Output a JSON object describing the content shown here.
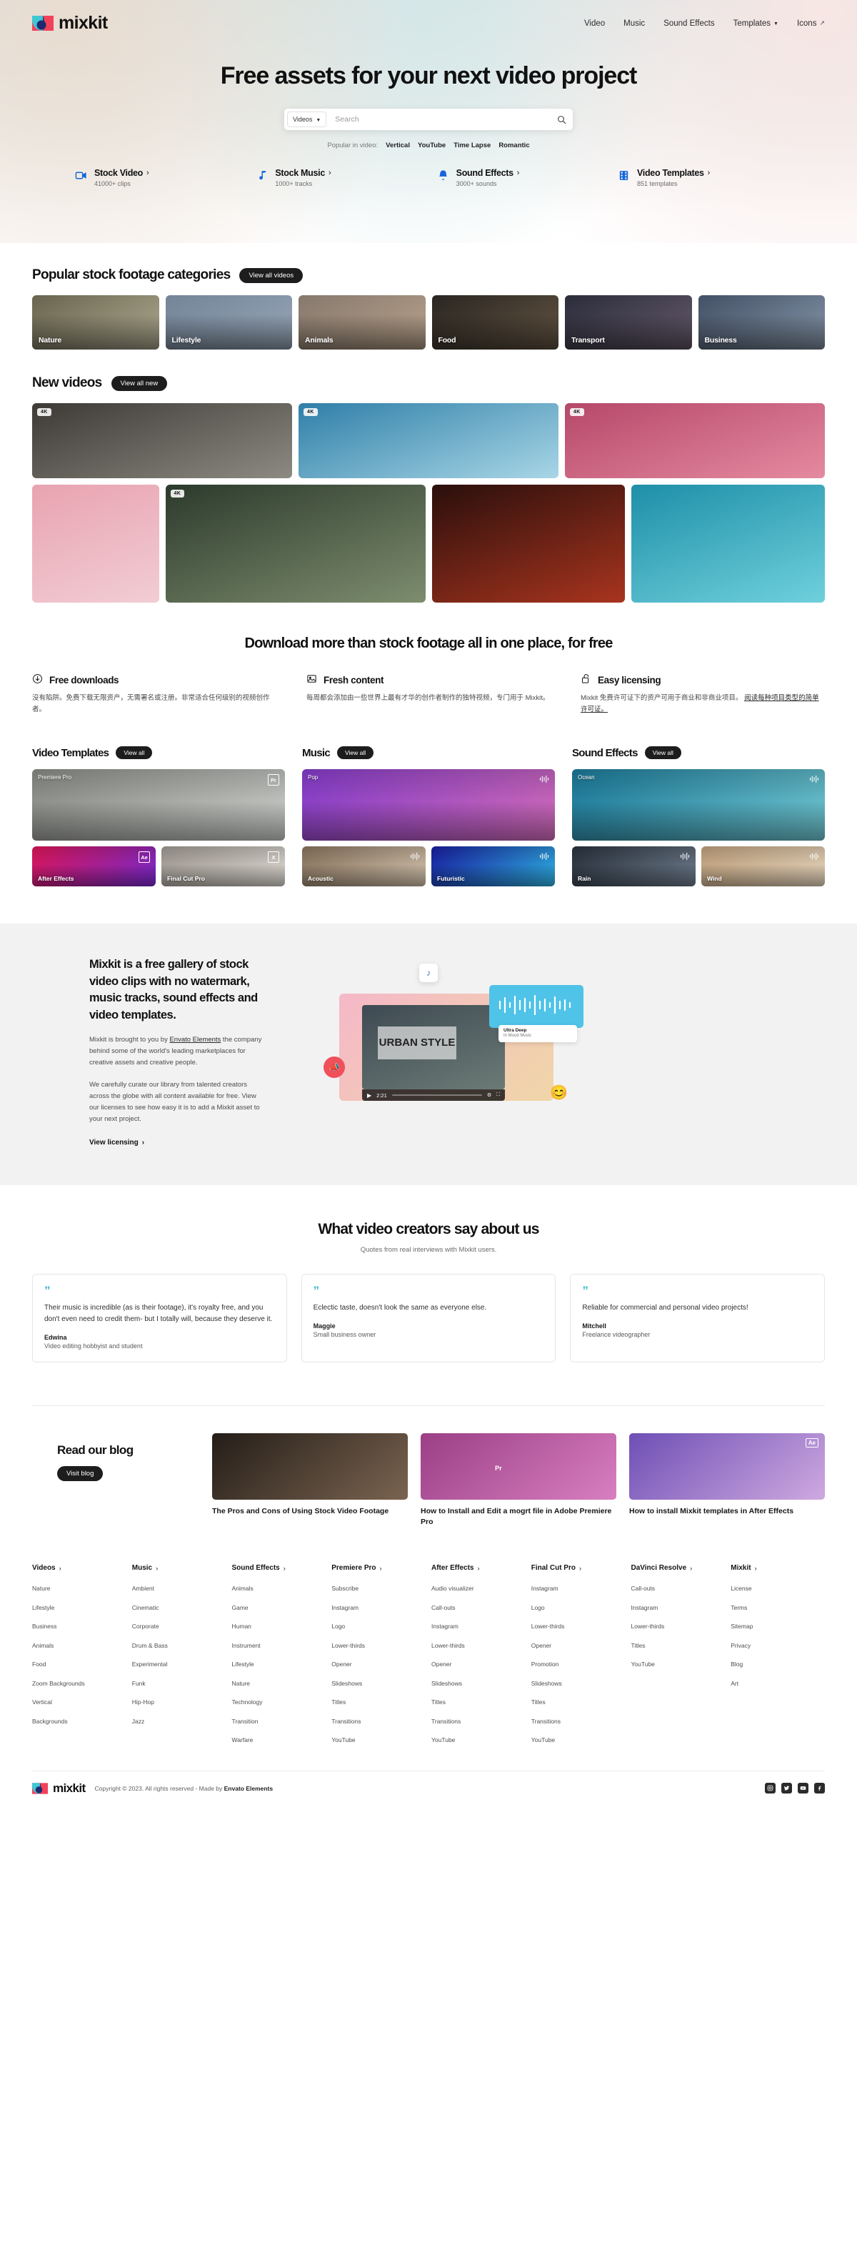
{
  "brand": {
    "name": "mixkit"
  },
  "nav": {
    "items": [
      {
        "label": "Video",
        "has_caret": false,
        "external": false
      },
      {
        "label": "Music",
        "has_caret": false,
        "external": false
      },
      {
        "label": "Sound Effects",
        "has_caret": false,
        "external": false
      },
      {
        "label": "Templates",
        "has_caret": true,
        "external": false
      },
      {
        "label": "Icons",
        "has_caret": false,
        "external": true
      }
    ]
  },
  "hero": {
    "title": "Free assets for your next video project",
    "search": {
      "scope": "Videos",
      "placeholder": "Search",
      "value": ""
    },
    "popular_label": "Popular in video:",
    "popular_tags": [
      "Vertical",
      "YouTube",
      "Time Lapse",
      "Romantic"
    ]
  },
  "shortcuts": [
    {
      "title": "Stock Video",
      "count": "41000+ clips",
      "icon": "video-camera-icon"
    },
    {
      "title": "Stock Music",
      "count": "1000+ tracks",
      "icon": "music-note-icon"
    },
    {
      "title": "Sound Effects",
      "count": "3000+ sounds",
      "icon": "bell-icon"
    },
    {
      "title": "Video Templates",
      "count": "851 templates",
      "icon": "film-strip-icon"
    }
  ],
  "categories_section": {
    "title": "Popular stock footage categories",
    "cta": "View all videos",
    "tiles": [
      {
        "label": "Nature",
        "c1": "#6d6a52",
        "c2": "#b9b49a"
      },
      {
        "label": "Lifestyle",
        "c1": "#7a8ba0",
        "c2": "#9fb0c2"
      },
      {
        "label": "Animals",
        "c1": "#8d7f73",
        "c2": "#c3ab93"
      },
      {
        "label": "Food",
        "c1": "#2b2722",
        "c2": "#6a5a48"
      },
      {
        "label": "Transport",
        "c1": "#2d2f3d",
        "c2": "#6b5f72"
      },
      {
        "label": "Business",
        "c1": "#46546a",
        "c2": "#8e9fb3"
      }
    ]
  },
  "new_videos_section": {
    "title": "New videos",
    "cta": "View all new",
    "items": [
      {
        "badge": "4K",
        "c1": "#3d3a36",
        "c2": "#8d8a82",
        "name": "woman-in-doorway"
      },
      {
        "badge": "4K",
        "c1": "#2f7fa8",
        "c2": "#a8d6e6",
        "name": "ocean-beach"
      },
      {
        "badge": "4K",
        "c1": "#b6486a",
        "c2": "#e58aa0",
        "name": "woman-in-poppy-field"
      },
      {
        "badge": "",
        "c1": "#e8a3b0",
        "c2": "#f2cdd4",
        "name": "hand-with-flower"
      },
      {
        "badge": "4K",
        "c1": "#2c3a2c",
        "c2": "#7d8d6e",
        "name": "dog-in-river"
      },
      {
        "badge": "",
        "c1": "#2a0f0c",
        "c2": "#a8341e",
        "name": "crab-closeup"
      },
      {
        "badge": "",
        "c1": "#1e8fa8",
        "c2": "#6fd0dc",
        "name": "woman-with-sunglasses"
      }
    ]
  },
  "features": {
    "title": "Download more than stock footage all in one place, for free",
    "cards": [
      {
        "icon": "download-circle-icon",
        "title": "Free downloads",
        "body": "没有陷阱。免费下载无限资产，无需署名或注册。非常适合任何级别的视频创作者。",
        "link": ""
      },
      {
        "icon": "image-icon",
        "title": "Fresh content",
        "body": "每周都会添加由一些世界上最有才华的创作者制作的独特视频，专门用于 Mixkit。",
        "link": ""
      },
      {
        "icon": "lock-open-icon",
        "title": "Easy licensing",
        "body": "Mixkit 免费许可证下的资产可用于商业和非商业项目。",
        "link": "阅读每种项目类型的简单许可证。"
      }
    ]
  },
  "asset_columns": [
    {
      "title": "Video Templates",
      "cta": "View all",
      "hero": {
        "tag": "Premiere Pro",
        "badge": "Pr",
        "name": "",
        "c1": "#8f918c",
        "c2": "#cfd2ce"
      },
      "minis": [
        {
          "tag": "",
          "badge": "Ae",
          "name": "After Effects",
          "c1": "#e8165c",
          "c2": "#7b2bd6"
        },
        {
          "tag": "",
          "badge": "X",
          "name": "Final Cut Pro",
          "c1": "#a6a098",
          "c2": "#e0dbd4"
        }
      ]
    },
    {
      "title": "Music",
      "cta": "View all",
      "hero": {
        "tag": "Pop",
        "badge": "",
        "name": "",
        "icon": "waveform-icon",
        "c1": "#8b3fd4",
        "c2": "#d86fc0"
      },
      "minis": [
        {
          "tag": "",
          "badge": "",
          "name": "Acoustic",
          "icon": "waveform-icon",
          "c1": "#8f7a63",
          "c2": "#d4c3ad"
        },
        {
          "tag": "",
          "badge": "",
          "name": "Futuristic",
          "icon": "waveform-icon",
          "c1": "#1a1fa8",
          "c2": "#2fb6e8"
        }
      ]
    },
    {
      "title": "Sound Effects",
      "cta": "View all",
      "hero": {
        "tag": "Ocean",
        "badge": "",
        "name": "",
        "icon": "waveform-icon",
        "c1": "#1c7fa0",
        "c2": "#73ccd8"
      },
      "minis": [
        {
          "tag": "",
          "badge": "",
          "name": "Rain",
          "icon": "waveform-icon",
          "c1": "#2b3440",
          "c2": "#6e7c8c"
        },
        {
          "tag": "",
          "badge": "",
          "name": "Wind",
          "icon": "waveform-icon",
          "c1": "#c8a882",
          "c2": "#ead8bf"
        }
      ]
    }
  ],
  "about": {
    "heading": "Mixkit is a free gallery of stock video clips with no watermark, music tracks, sound effects and video templates.",
    "p1_before": "Mixkit is brought to you by ",
    "p1_link": "Envato Elements",
    "p1_after": " the company behind some of the world's leading marketplaces for creative assets and creative people.",
    "p2": "We carefully curate our library from talented creators across the globe with all content available for free. View our licenses to see how easy it is to add a Mixkit asset to your next project.",
    "link": "View licensing",
    "media": {
      "video_time": "2:21",
      "overlay_text": "URBAN STYLE",
      "track_title": "Ultra Deep",
      "track_sub": "In Mood Music"
    }
  },
  "testimonials": {
    "title": "What video creators say about us",
    "subtitle": "Quotes from real interviews with Mixkit users.",
    "items": [
      {
        "text": "Their music is incredible (as is their footage), it's royalty free, and you don't even need to credit them- but I totally will, because they deserve it.",
        "name": "Edwina",
        "role": "Video editing hobbyist and student"
      },
      {
        "text": "Eclectic taste, doesn't look the same as everyone else.",
        "name": "Maggie",
        "role": "Small business owner"
      },
      {
        "text": "Reliable for commercial and personal video projects!",
        "name": "Mitchell",
        "role": "Freelance videographer"
      }
    ]
  },
  "blog": {
    "title": "Read our blog",
    "cta": "Visit blog",
    "posts": [
      {
        "title": "The Pros and Cons of Using Stock Video Footage",
        "c1": "#241d18",
        "c2": "#7a6450"
      },
      {
        "title": "How to Install and Edit a mogrt file in Adobe Premiere Pro",
        "c1": "#9b3f86",
        "c2": "#d87fc0"
      },
      {
        "title": "How to install Mixkit templates in After Effects",
        "c1": "#6e4fb5",
        "c2": "#cfa9e0"
      }
    ]
  },
  "footer": {
    "columns": [
      {
        "title": "Videos",
        "links": [
          "Nature",
          "Lifestyle",
          "Business",
          "Animals",
          "Food",
          "Zoom Backgrounds",
          "Vertical",
          "Backgrounds"
        ]
      },
      {
        "title": "Music",
        "links": [
          "Ambient",
          "Cinematic",
          "Corporate",
          "Drum & Bass",
          "Experimental",
          "Funk",
          "Hip-Hop",
          "Jazz"
        ]
      },
      {
        "title": "Sound Effects",
        "links": [
          "Animals",
          "Game",
          "Human",
          "Instrument",
          "Lifestyle",
          "Nature",
          "Technology",
          "Transition",
          "Warfare"
        ]
      },
      {
        "title": "Premiere Pro",
        "links": [
          "Subscribe",
          "Instagram",
          "Logo",
          "Lower-thirds",
          "Opener",
          "Slideshows",
          "Titles",
          "Transitions",
          "YouTube"
        ]
      },
      {
        "title": "After Effects",
        "links": [
          "Audio visualizer",
          "Call-outs",
          "Instagram",
          "Lower-thirds",
          "Opener",
          "Slideshows",
          "Titles",
          "Transitions",
          "YouTube"
        ]
      },
      {
        "title": "Final Cut Pro",
        "links": [
          "Instagram",
          "Logo",
          "Lower-thirds",
          "Opener",
          "Promotion",
          "Slideshows",
          "Titles",
          "Transitions",
          "YouTube"
        ]
      },
      {
        "title": "DaVinci Resolve",
        "links": [
          "Call-outs",
          "Instagram",
          "Lower-thirds",
          "Titles",
          "YouTube"
        ]
      },
      {
        "title": "Mixkit",
        "links": [
          "License",
          "Terms",
          "Sitemap",
          "Privacy",
          "Blog",
          "Art"
        ]
      }
    ],
    "copyright_before": "Copyright © 2023. All rights reserved - Made by ",
    "copyright_link": "Envato Elements",
    "socials": [
      "instagram-icon",
      "twitter-icon",
      "youtube-icon",
      "facebook-icon"
    ]
  },
  "colors": {
    "accent": "#1565d8",
    "dark": "#1d1d1d",
    "quote": "#3bb8c9"
  }
}
